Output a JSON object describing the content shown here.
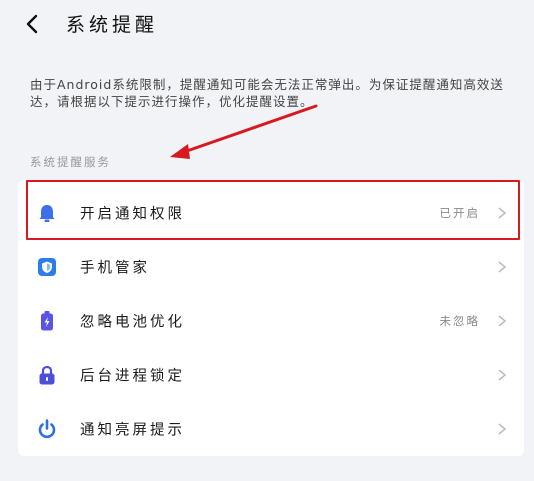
{
  "header": {
    "title": "系统提醒",
    "back_icon": "chevron-left-icon"
  },
  "description": "由于Android系统限制，提醒通知可能会无法正常弹出。为保证提醒通知高效送达，请根据以下提示进行操作，优化提醒设置。",
  "section": {
    "label": "系统提醒服务"
  },
  "items": [
    {
      "label": "开启通知权限",
      "status": "已开启",
      "icon": "bell-icon",
      "icon_color": "#3d6fe8"
    },
    {
      "label": "手机管家",
      "status": "",
      "icon": "shield-icon",
      "icon_color": "#2b7de9"
    },
    {
      "label": "忽略电池优化",
      "status": "未忽略",
      "icon": "battery-icon",
      "icon_color": "#5a54e6"
    },
    {
      "label": "后台进程锁定",
      "status": "",
      "icon": "lock-icon",
      "icon_color": "#4c4fd8"
    },
    {
      "label": "通知亮屏提示",
      "status": "",
      "icon": "power-icon",
      "icon_color": "#2f6fe6"
    }
  ],
  "annotation": {
    "highlight_color": "#d71a20"
  }
}
